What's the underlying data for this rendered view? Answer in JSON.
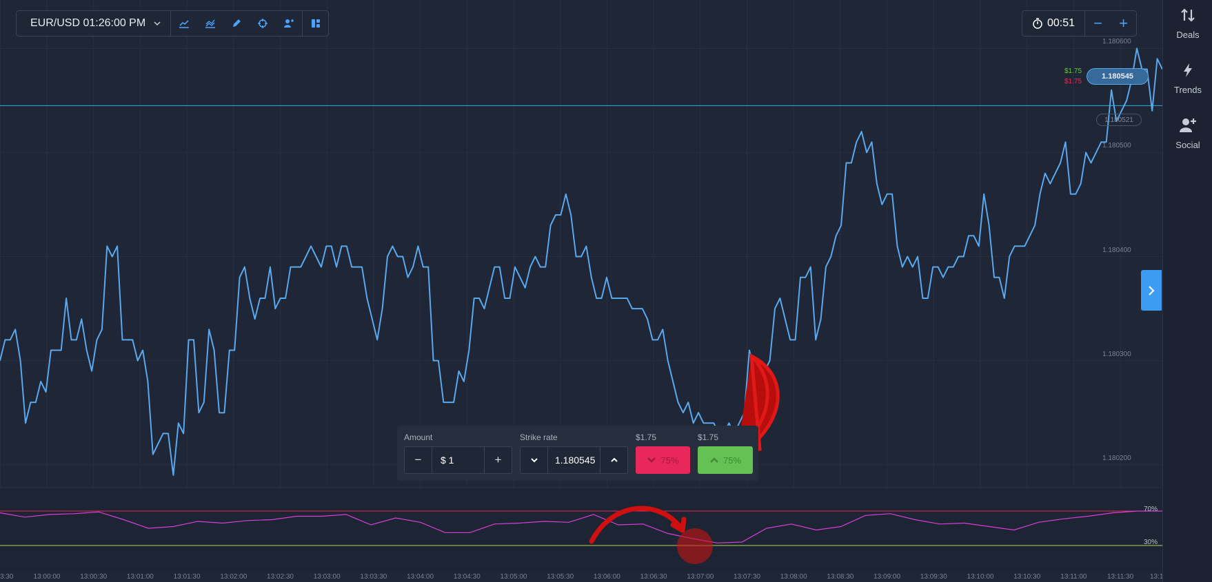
{
  "toolbar": {
    "asset_label": "EUR/USD 01:26:00 PM",
    "tools": [
      "line-chart-icon",
      "indicators-icon",
      "draw-pen-icon",
      "crosshair-icon",
      "add-friend-icon",
      "layout-grid-icon"
    ]
  },
  "timer": {
    "value": "00:51",
    "minus": "−",
    "plus": "+"
  },
  "sidebar": {
    "items": [
      {
        "label": "Deals",
        "icon": "up-down-arrows-icon"
      },
      {
        "label": "Trends",
        "icon": "lightning-icon"
      },
      {
        "label": "Social",
        "icon": "add-user-icon"
      }
    ]
  },
  "price": {
    "current": "1.180545",
    "strike_marker": "1.180521",
    "payout_up": "$1.75",
    "payout_down": "$1.75"
  },
  "y_axis": {
    "ticks": [
      {
        "label": "1.180600",
        "value": 1.1806
      },
      {
        "label": "1.180500",
        "value": 1.1805
      },
      {
        "label": "1.180400",
        "value": 1.1804
      },
      {
        "label": "1.180300",
        "value": 1.1803
      },
      {
        "label": "1.180200",
        "value": 1.1802
      }
    ]
  },
  "x_axis": {
    "ticks": [
      "13:00:00",
      "13:00:30",
      "13:01:00",
      "13:01:30",
      "13:02:00",
      "13:02:30",
      "13:03:00",
      "13:03:30",
      "13:04:00",
      "13:04:30",
      "13:05:00",
      "13:05:30",
      "13:06:00",
      "13:06:30",
      "13:07:00",
      "13:07:30",
      "13:08:00",
      "13:08:30",
      "13:09:00",
      "13:09:30",
      "13:10:00",
      "13:10:30",
      "13:11:00",
      "13:11:30"
    ],
    "left_partial": "3:30",
    "right_partial": "13:1"
  },
  "rsi": {
    "upper_label": "70%",
    "lower_label": "30%",
    "upper": 70,
    "lower": 30,
    "values": [
      68,
      63,
      66,
      67,
      69,
      60,
      50,
      52,
      58,
      56,
      59,
      60,
      64,
      64,
      66,
      54,
      62,
      57,
      45,
      45,
      55,
      56,
      58,
      57,
      66,
      54,
      55,
      44,
      38,
      33,
      34,
      50,
      55,
      48,
      52,
      65,
      67,
      60,
      55,
      56,
      52,
      48,
      57,
      61,
      64,
      68,
      70,
      70
    ]
  },
  "trade_panel": {
    "amount_label": "Amount",
    "amount_value": "$ 1",
    "strike_label": "Strike rate",
    "strike_value": "1.180545",
    "down_payout": "$1.75",
    "up_payout": "$1.75",
    "down_percent": "75%",
    "up_percent": "75%",
    "minus": "−",
    "plus": "+"
  },
  "colors": {
    "background": "#1f2636",
    "price_line": "#5aa9ee",
    "rsi_line": "#d83fd8",
    "rsi_upper": "#e0315b",
    "rsi_lower": "#b6d94c",
    "up_button": "#63c253",
    "down_button": "#e8285b",
    "accent": "#3b9cf2",
    "annotation": "#d60a0a"
  },
  "chart_data": {
    "type": "line",
    "title": "",
    "xlabel": "",
    "ylabel": "",
    "ylim": [
      1.18018,
      1.18062
    ],
    "current_price": 1.180545,
    "series": [
      {
        "values": [
          1.1803,
          1.18032,
          1.18032,
          1.18033,
          1.1803,
          1.18024,
          1.18026,
          1.18026,
          1.18028,
          1.18027,
          1.18031,
          1.18031,
          1.18031,
          1.18036,
          1.18032,
          1.18032,
          1.18034,
          1.18031,
          1.18029,
          1.18032,
          1.18033,
          1.18041,
          1.1804,
          1.18041,
          1.18032,
          1.18032,
          1.18032,
          1.1803,
          1.18031,
          1.18028,
          1.18021,
          1.18022,
          1.18023,
          1.18023,
          1.18019,
          1.18024,
          1.18023,
          1.18032,
          1.18032,
          1.18025,
          1.18026,
          1.18033,
          1.18031,
          1.18025,
          1.18025,
          1.18031,
          1.18031,
          1.18038,
          1.18039,
          1.18036,
          1.18034,
          1.18036,
          1.18036,
          1.18039,
          1.18035,
          1.18036,
          1.18036,
          1.18039,
          1.18039,
          1.18039,
          1.1804,
          1.18041,
          1.1804,
          1.18039,
          1.18041,
          1.18041,
          1.18039,
          1.18041,
          1.18041,
          1.18039,
          1.18039,
          1.18039,
          1.18036,
          1.18034,
          1.18032,
          1.18035,
          1.1804,
          1.18041,
          1.1804,
          1.1804,
          1.18038,
          1.18039,
          1.18041,
          1.18039,
          1.18039,
          1.1803,
          1.1803,
          1.18026,
          1.18026,
          1.18026,
          1.18029,
          1.18028,
          1.18031,
          1.18036,
          1.18036,
          1.18035,
          1.18037,
          1.18039,
          1.18039,
          1.18036,
          1.18036,
          1.18039,
          1.18038,
          1.18037,
          1.18039,
          1.1804,
          1.18039,
          1.18039,
          1.18043,
          1.18044,
          1.18044,
          1.18046,
          1.18044,
          1.1804,
          1.1804,
          1.18041,
          1.18038,
          1.18036,
          1.18036,
          1.18038,
          1.18036,
          1.18036,
          1.18036,
          1.18036,
          1.18035,
          1.18035,
          1.18035,
          1.18034,
          1.18032,
          1.18032,
          1.18033,
          1.1803,
          1.18028,
          1.18026,
          1.18025,
          1.18026,
          1.18024,
          1.18025,
          1.18024,
          1.18024,
          1.18024,
          1.18023,
          1.18023,
          1.18024,
          1.18023,
          1.18024,
          1.18025,
          1.18031,
          1.18029,
          1.1803,
          1.18029,
          1.1803,
          1.18035,
          1.18036,
          1.18034,
          1.18032,
          1.18032,
          1.18038,
          1.18038,
          1.18039,
          1.18032,
          1.18034,
          1.18039,
          1.1804,
          1.18042,
          1.18043,
          1.18049,
          1.18049,
          1.18051,
          1.18052,
          1.1805,
          1.18051,
          1.18047,
          1.18045,
          1.18046,
          1.18046,
          1.18041,
          1.18039,
          1.1804,
          1.18039,
          1.1804,
          1.18036,
          1.18036,
          1.18039,
          1.18039,
          1.18038,
          1.18039,
          1.18039,
          1.1804,
          1.1804,
          1.18042,
          1.18042,
          1.18041,
          1.18046,
          1.18043,
          1.18038,
          1.18038,
          1.18036,
          1.1804,
          1.18041,
          1.18041,
          1.18041,
          1.18042,
          1.18043,
          1.18046,
          1.18048,
          1.18047,
          1.18048,
          1.18049,
          1.18051,
          1.18046,
          1.18046,
          1.18047,
          1.1805,
          1.18049,
          1.1805,
          1.18051,
          1.18051,
          1.18056,
          1.18053,
          1.18054,
          1.18055,
          1.18057,
          1.1806,
          1.18058,
          1.18058,
          1.18054,
          1.18059,
          1.18058
        ]
      }
    ]
  }
}
